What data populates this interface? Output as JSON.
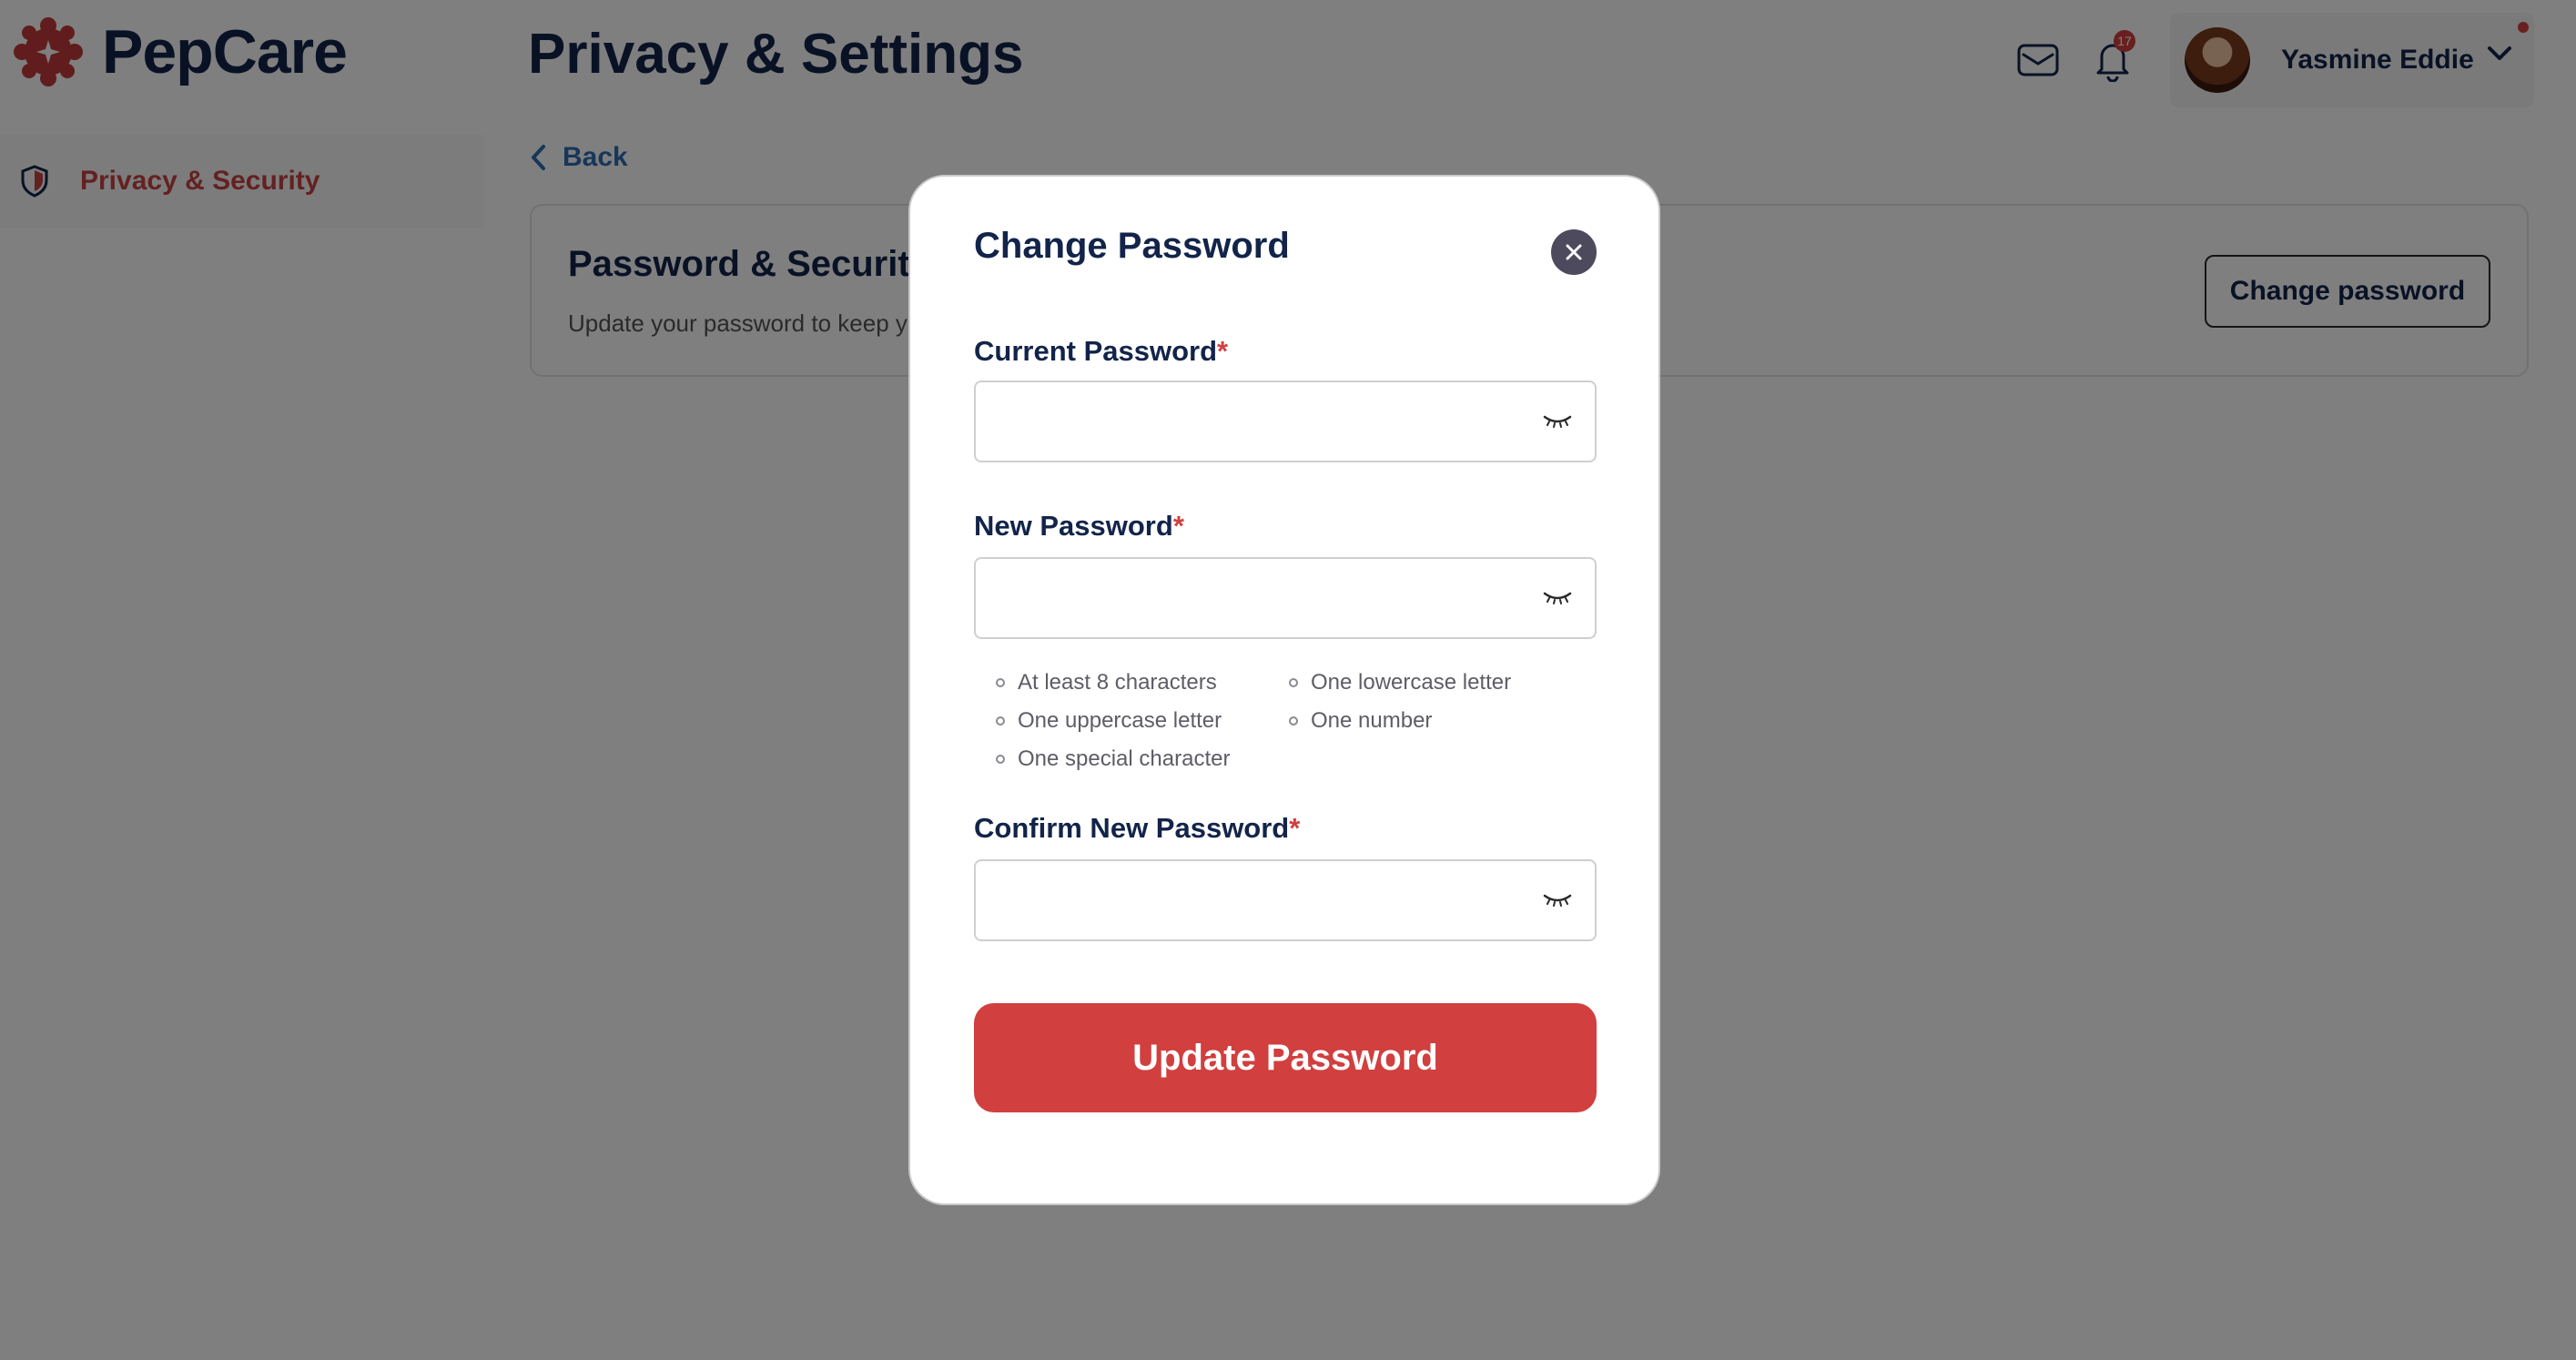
{
  "app": {
    "name": "PepCare"
  },
  "header": {
    "title": "Privacy & Settings",
    "notification_count": "17",
    "user_name": "Yasmine Eddie"
  },
  "sidebar": {
    "items": [
      {
        "label": "Privacy & Security",
        "icon": "shield-icon"
      }
    ]
  },
  "main": {
    "back_label": "Back",
    "card": {
      "title": "Password & Security",
      "subtitle": "Update your password to keep yo",
      "button_label": "Change password"
    }
  },
  "modal": {
    "title": "Change Password",
    "current_password": {
      "label": "Current Password",
      "required_mark": "*",
      "value": ""
    },
    "new_password": {
      "label": "New Password",
      "required_mark": "*",
      "value": ""
    },
    "confirm_password": {
      "label": "Confirm New Password",
      "required_mark": "*",
      "value": ""
    },
    "rules": [
      "At least 8 characters",
      "One lowercase letter",
      "One uppercase letter",
      "One number",
      "One special character"
    ],
    "submit_label": "Update Password"
  },
  "colors": {
    "brand": "#13244a",
    "accent": "#d13f3f",
    "link": "#2f6fb3"
  }
}
